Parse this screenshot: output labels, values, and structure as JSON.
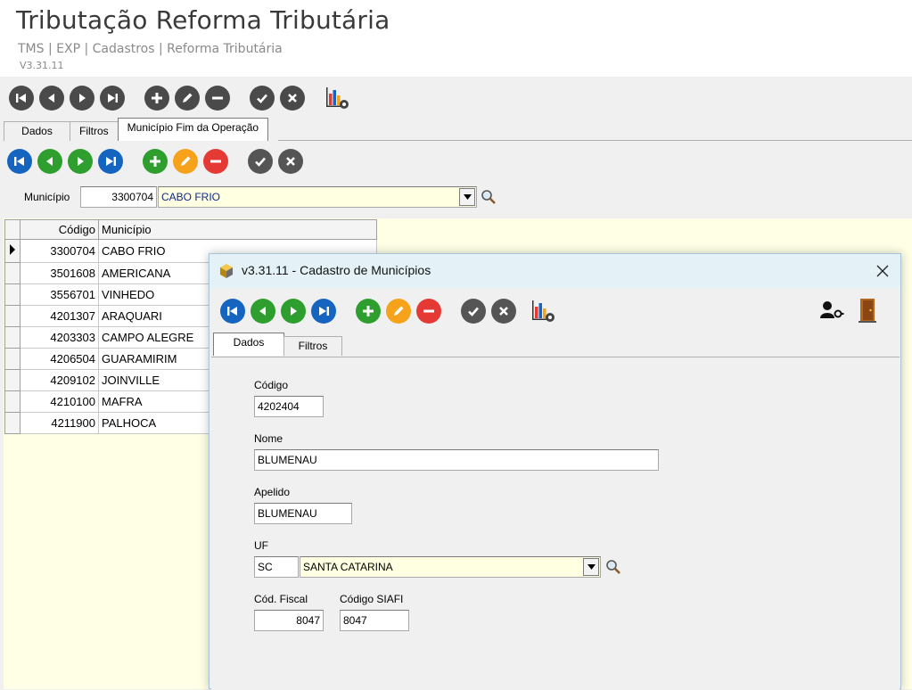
{
  "header": {
    "title": "Tributação Reforma Tributária",
    "breadcrumb": "TMS | EXP | Cadastros | Reforma Tributária",
    "version": "V3.31.11"
  },
  "main": {
    "tabs": [
      {
        "label": "Dados"
      },
      {
        "label": "Filtros"
      },
      {
        "label": "Município Fim da Operação"
      }
    ],
    "municipio_label": "Município",
    "municipio_code": "3300704",
    "municipio_name": "CABO FRIO",
    "grid": {
      "headers": [
        "Código",
        "Município"
      ],
      "rows": [
        {
          "code": "3300704",
          "name": "CABO FRIO"
        },
        {
          "code": "3501608",
          "name": "AMERICANA"
        },
        {
          "code": "3556701",
          "name": "VINHEDO"
        },
        {
          "code": "4201307",
          "name": "ARAQUARI"
        },
        {
          "code": "4203303",
          "name": "CAMPO ALEGRE"
        },
        {
          "code": "4206504",
          "name": "GUARAMIRIM"
        },
        {
          "code": "4209102",
          "name": "JOINVILLE"
        },
        {
          "code": "4210100",
          "name": "MAFRA"
        },
        {
          "code": "4211900",
          "name": "PALHOCA"
        }
      ]
    }
  },
  "modal": {
    "title": "v3.31.11 - Cadastro de Municípios",
    "tabs": [
      {
        "label": "Dados"
      },
      {
        "label": "Filtros"
      }
    ],
    "fields": {
      "codigo_label": "Código",
      "codigo_value": "4202404",
      "nome_label": "Nome",
      "nome_value": "BLUMENAU",
      "apelido_label": "Apelido",
      "apelido_value": "BLUMENAU",
      "uf_label": "UF",
      "uf_code": "SC",
      "uf_name": "SANTA CATARINA",
      "cod_fiscal_label": "Cód. Fiscal",
      "cod_fiscal_value": "8047",
      "codigo_siafi_label": "Código SIAFI",
      "codigo_siafi_value": "8047"
    }
  },
  "colors": {
    "nav_blue": "#1565c0",
    "add_green": "#2e9e2e",
    "edit_orange": "#f6a21a",
    "delete_red": "#e53935",
    "dark_button": "#4a4a4a",
    "grid_background": "#ffffe6",
    "modal_titlebar": "#e4f2f7"
  }
}
